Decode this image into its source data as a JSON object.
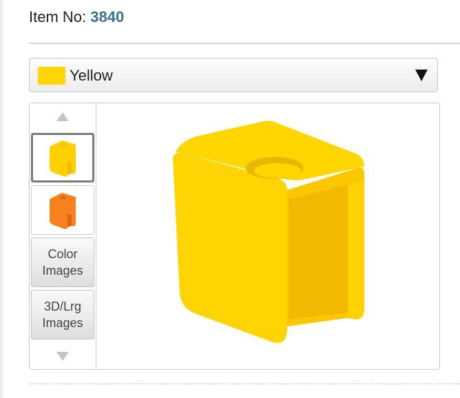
{
  "item": {
    "label": "Item No: ",
    "number": "3840"
  },
  "color_select": {
    "selected": "Yellow",
    "swatch_color": "#ffd600"
  },
  "thumbnails": [
    {
      "name": "yellow-part-thumb",
      "color": "#ffd000",
      "shade": "#f1bc00",
      "selected": true
    },
    {
      "name": "orange-part-thumb",
      "color": "#f7811f",
      "shade": "#e06a10",
      "selected": false
    }
  ],
  "buttons": {
    "color_images": [
      "Color",
      "Images"
    ],
    "large_images": [
      "3D/Lrg",
      "Images"
    ]
  },
  "colors": {
    "accent_number": "#3a7096",
    "main_part": "#ffd400"
  },
  "icons": {
    "scroll_up": "triangle-up-icon",
    "scroll_down": "triangle-down-icon",
    "dropdown": "caret-down-icon"
  }
}
